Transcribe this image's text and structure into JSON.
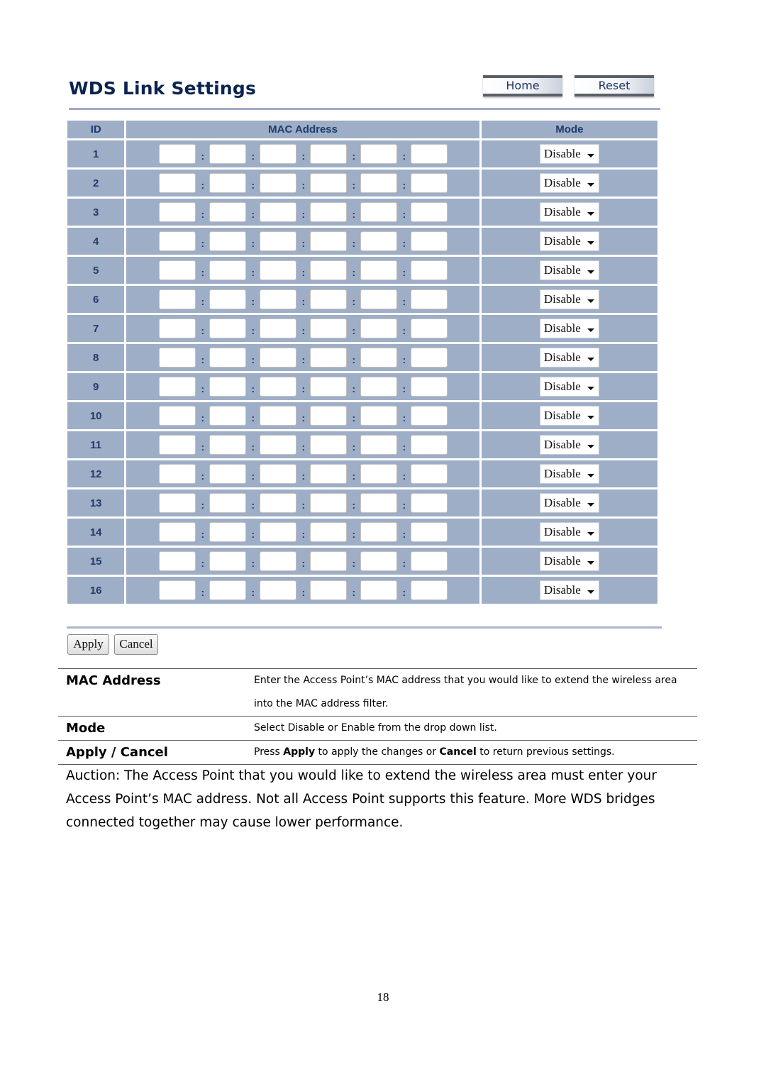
{
  "header": {
    "title": "WDS Link Settings",
    "home_label": "Home",
    "reset_label": "Reset"
  },
  "table": {
    "columns": [
      "ID",
      "MAC Address",
      "Mode"
    ],
    "mac_separator": ":",
    "mode_options_visible": "Disable",
    "rows": [
      {
        "id": "1",
        "mac": [
          "",
          "",
          "",
          "",
          "",
          ""
        ],
        "mode": "Disable"
      },
      {
        "id": "2",
        "mac": [
          "",
          "",
          "",
          "",
          "",
          ""
        ],
        "mode": "Disable"
      },
      {
        "id": "3",
        "mac": [
          "",
          "",
          "",
          "",
          "",
          ""
        ],
        "mode": "Disable"
      },
      {
        "id": "4",
        "mac": [
          "",
          "",
          "",
          "",
          "",
          ""
        ],
        "mode": "Disable"
      },
      {
        "id": "5",
        "mac": [
          "",
          "",
          "",
          "",
          "",
          ""
        ],
        "mode": "Disable"
      },
      {
        "id": "6",
        "mac": [
          "",
          "",
          "",
          "",
          "",
          ""
        ],
        "mode": "Disable"
      },
      {
        "id": "7",
        "mac": [
          "",
          "",
          "",
          "",
          "",
          ""
        ],
        "mode": "Disable"
      },
      {
        "id": "8",
        "mac": [
          "",
          "",
          "",
          "",
          "",
          ""
        ],
        "mode": "Disable"
      },
      {
        "id": "9",
        "mac": [
          "",
          "",
          "",
          "",
          "",
          ""
        ],
        "mode": "Disable"
      },
      {
        "id": "10",
        "mac": [
          "",
          "",
          "",
          "",
          "",
          ""
        ],
        "mode": "Disable"
      },
      {
        "id": "11",
        "mac": [
          "",
          "",
          "",
          "",
          "",
          ""
        ],
        "mode": "Disable"
      },
      {
        "id": "12",
        "mac": [
          "",
          "",
          "",
          "",
          "",
          ""
        ],
        "mode": "Disable"
      },
      {
        "id": "13",
        "mac": [
          "",
          "",
          "",
          "",
          "",
          ""
        ],
        "mode": "Disable"
      },
      {
        "id": "14",
        "mac": [
          "",
          "",
          "",
          "",
          "",
          ""
        ],
        "mode": "Disable"
      },
      {
        "id": "15",
        "mac": [
          "",
          "",
          "",
          "",
          "",
          ""
        ],
        "mode": "Disable"
      },
      {
        "id": "16",
        "mac": [
          "",
          "",
          "",
          "",
          "",
          ""
        ],
        "mode": "Disable"
      }
    ]
  },
  "form": {
    "apply_label": "Apply",
    "cancel_label": "Cancel"
  },
  "descriptions": [
    {
      "term": "MAC Address",
      "text_parts": [
        {
          "t": "Enter the Access Point’s MAC address that you would like to extend the wireless area into the MAC address filter.",
          "b": false
        }
      ]
    },
    {
      "term": "Mode",
      "text_parts": [
        {
          "t": "Select Disable or Enable from the drop down list.",
          "b": false
        }
      ]
    },
    {
      "term": "Apply / Cancel",
      "text_parts": [
        {
          "t": "Press ",
          "b": false
        },
        {
          "t": "Apply",
          "b": true
        },
        {
          "t": " to apply the changes or ",
          "b": false
        },
        {
          "t": "Cancel",
          "b": true
        },
        {
          "t": " to return previous settings.",
          "b": false
        }
      ]
    }
  ],
  "note": "Auction: The Access Point that you would like to extend the wireless area must enter your Access Point’s MAC address. Not all Access Point supports this feature. More WDS bridges connected together may cause lower performance.",
  "page_number": "18"
}
